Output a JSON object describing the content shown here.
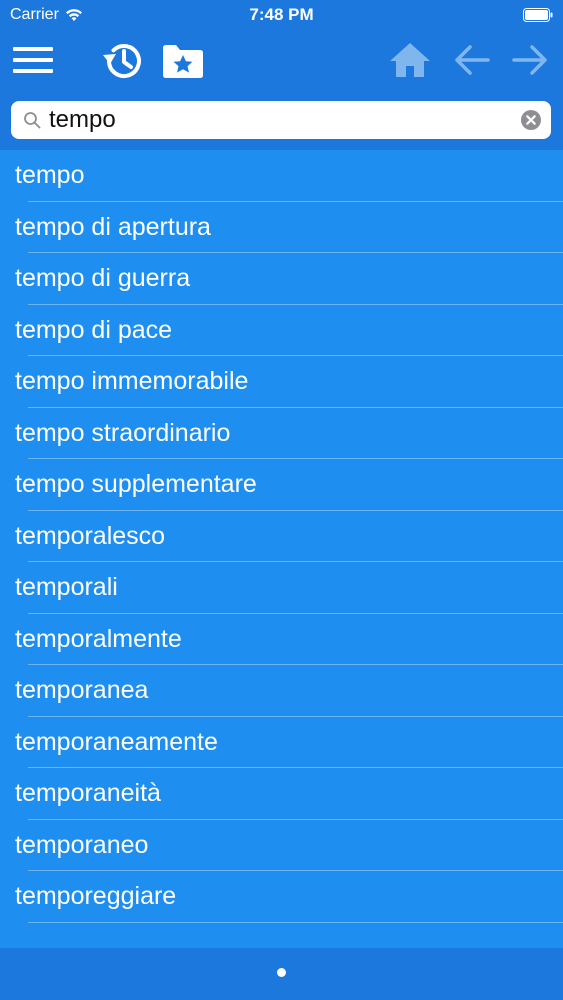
{
  "status_bar": {
    "carrier": "Carrier",
    "time": "7:48 PM"
  },
  "toolbar": {
    "icons": [
      "menu-icon",
      "history-icon",
      "favorites-folder-icon",
      "home-icon",
      "back-arrow-icon",
      "forward-arrow-icon"
    ]
  },
  "search": {
    "value": "tempo",
    "placeholder": ""
  },
  "results": [
    {
      "label": "tempo"
    },
    {
      "label": "tempo di apertura"
    },
    {
      "label": "tempo di guerra"
    },
    {
      "label": "tempo di pace"
    },
    {
      "label": "tempo immemorabile"
    },
    {
      "label": "tempo straordinario"
    },
    {
      "label": "tempo supplementare"
    },
    {
      "label": "temporalesco"
    },
    {
      "label": "temporali"
    },
    {
      "label": "temporalmente"
    },
    {
      "label": "temporanea"
    },
    {
      "label": "temporaneamente"
    },
    {
      "label": "temporaneità"
    },
    {
      "label": "temporaneo"
    },
    {
      "label": "temporeggiare"
    }
  ],
  "colors": {
    "header": "#1c78dd",
    "list_background": "#1e8ef0",
    "text": "#ffffff",
    "disabled_icon": "#7fb6ee"
  }
}
